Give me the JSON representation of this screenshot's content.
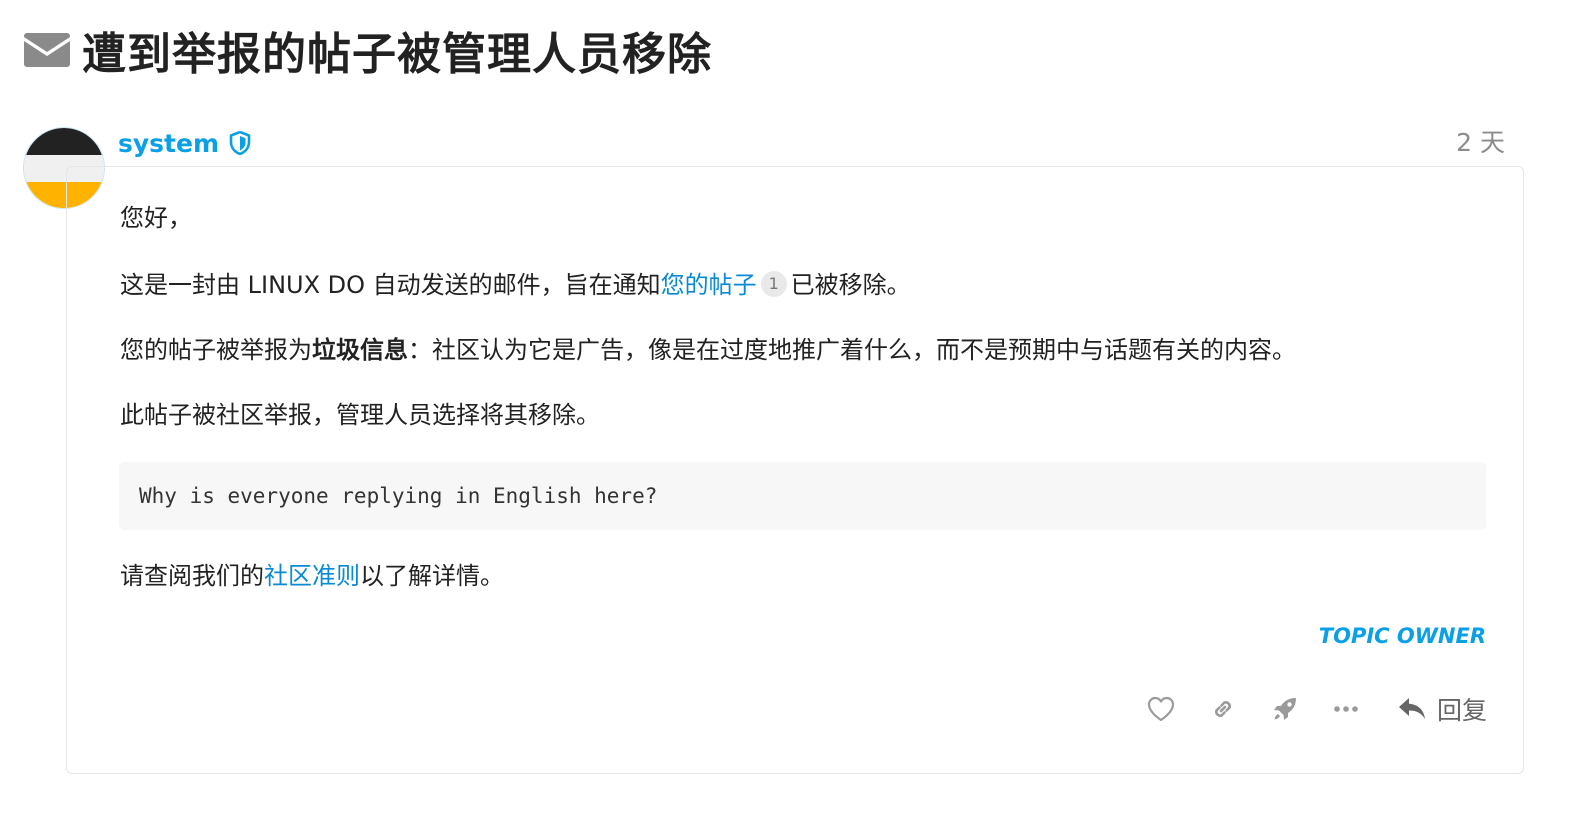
{
  "title": "遭到举报的帖子被管理人员移除",
  "post": {
    "username": "system",
    "date": "2 天",
    "greeting": "您好，",
    "notice": {
      "before": "这是一封由 LINUX DO 自动发送的邮件，旨在通知",
      "link": "您的帖子",
      "badge": "1",
      "after": "已被移除。"
    },
    "reason": {
      "before": "您的帖子被举报为",
      "bold": "垃圾信息",
      "after": "：社区认为它是广告，像是在过度地推广着什么，而不是预期中与话题有关的内容。"
    },
    "action_text": "此帖子被社区举报，管理人员选择将其移除。",
    "quoted_post": "Why is everyone replying in English here?",
    "guidelines": {
      "before": "请查阅我们的",
      "link": "社区准则",
      "after": "以了解详情。"
    },
    "owner_label": "TOPIC OWNER",
    "reply_label": "回复"
  },
  "icons": {
    "title": "envelope-icon",
    "badge": "shield-icon",
    "like": "heart-icon",
    "copy_link": "link-icon",
    "boost": "rocket-icon",
    "more": "ellipsis-icon",
    "reply": "reply-arrow-icon"
  },
  "colors": {
    "accent": "#0aa0e6",
    "link": "#0a8ad4",
    "muted": "#8c8c8c",
    "avatar_top": "#222222",
    "avatar_middle": "#f0f0f0",
    "avatar_bottom": "#ffb300"
  }
}
